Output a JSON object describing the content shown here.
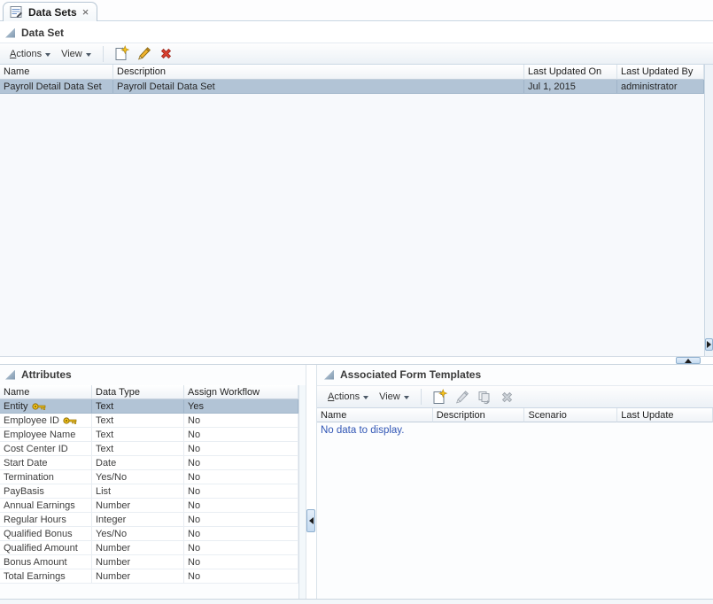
{
  "tab": {
    "label": "Data Sets",
    "close_glyph": "×"
  },
  "panels": {
    "data_set": {
      "title": "Data Set",
      "toolbar": {
        "actions_label": "Actions",
        "view_label": "View"
      },
      "columns": [
        "Name",
        "Description",
        "Last Updated On",
        "Last Updated By"
      ],
      "rows": [
        {
          "name": "Payroll Detail Data Set",
          "description": "Payroll Detail Data Set",
          "last_updated_on": "Jul 1, 2015",
          "last_updated_by": "administrator",
          "selected": true
        }
      ]
    },
    "attributes": {
      "title": "Attributes",
      "columns": [
        "Name",
        "Data Type",
        "Assign Workflow"
      ],
      "rows": [
        {
          "name": "Entity",
          "key": true,
          "type": "Text",
          "workflow": "Yes",
          "selected": true
        },
        {
          "name": "Employee ID",
          "key": true,
          "type": "Text",
          "workflow": "No"
        },
        {
          "name": "Employee Name",
          "key": false,
          "type": "Text",
          "workflow": "No"
        },
        {
          "name": "Cost Center ID",
          "key": false,
          "type": "Text",
          "workflow": "No"
        },
        {
          "name": "Start Date",
          "key": false,
          "type": "Date",
          "workflow": "No"
        },
        {
          "name": "Termination",
          "key": false,
          "type": "Yes/No",
          "workflow": "No"
        },
        {
          "name": "PayBasis",
          "key": false,
          "type": "List",
          "workflow": "No"
        },
        {
          "name": "Annual Earnings",
          "key": false,
          "type": "Number",
          "workflow": "No"
        },
        {
          "name": "Regular Hours",
          "key": false,
          "type": "Integer",
          "workflow": "No"
        },
        {
          "name": "Qualified Bonus",
          "key": false,
          "type": "Yes/No",
          "workflow": "No"
        },
        {
          "name": "Qualified Amount",
          "key": false,
          "type": "Number",
          "workflow": "No"
        },
        {
          "name": "Bonus Amount",
          "key": false,
          "type": "Number",
          "workflow": "No"
        },
        {
          "name": "Total Earnings",
          "key": false,
          "type": "Number",
          "workflow": "No"
        }
      ]
    },
    "form_templates": {
      "title": "Associated Form Templates",
      "toolbar": {
        "actions_label": "Actions",
        "view_label": "View"
      },
      "columns": [
        "Name",
        "Description",
        "Scenario",
        "Last Update"
      ],
      "empty_text": "No data to display."
    }
  },
  "icons": {
    "tab_icon": "grid-with-pencil",
    "new": "page-with-gold-star",
    "edit": "gold-pencil",
    "delete": "red-x",
    "move": "copy-pages-with-arrow",
    "key": "gold-key",
    "disclosure": "expanded-triangle"
  },
  "colors": {
    "selection_bg": "#b2c4d6",
    "no_data_text": "#3156b5",
    "delete_red": "#d8402f",
    "icon_gold": "#f4c51d",
    "header_border": "#c2cfdc",
    "toolbar_border": "#ccd8e4"
  }
}
